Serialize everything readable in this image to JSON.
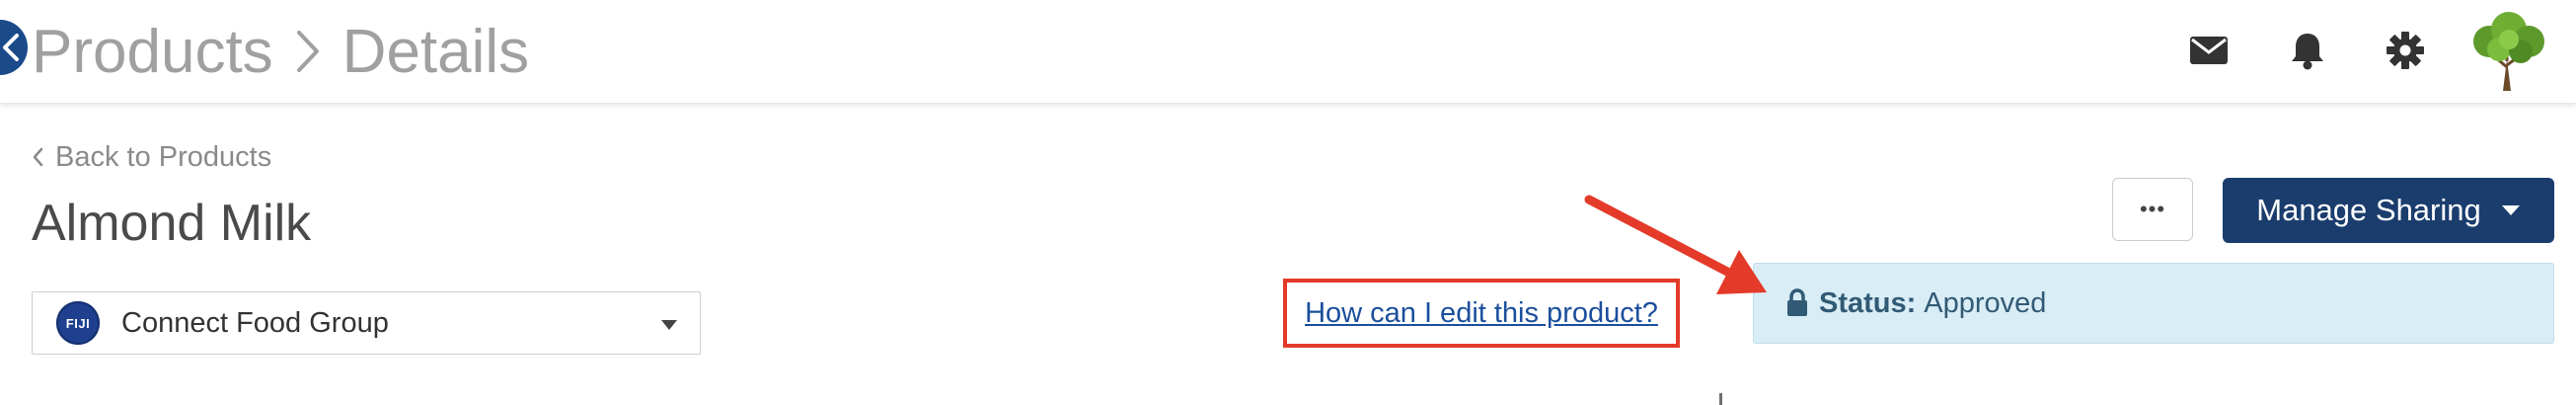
{
  "header": {
    "breadcrumb": [
      "Products",
      "Details"
    ],
    "icons": [
      "mail-icon",
      "bell-icon",
      "gear-icon"
    ],
    "avatar": "tree-avatar"
  },
  "page": {
    "back_link": "Back to Products",
    "title": "Almond Milk"
  },
  "company_select": {
    "logo_text": "FIJI",
    "selected": "Connect Food Group"
  },
  "help": {
    "link_text": "How can I edit this product?"
  },
  "actions": {
    "more_label": "•••",
    "manage_sharing_label": "Manage Sharing"
  },
  "status": {
    "label": "Status:",
    "value": "Approved"
  },
  "colors": {
    "primary": "#1a3d6e",
    "breadcrumb_text": "#a0a0a0",
    "link": "#1b4f9c",
    "annotation": "#e43a2a",
    "status_bg": "#d9edf6",
    "status_text": "#315a75"
  }
}
